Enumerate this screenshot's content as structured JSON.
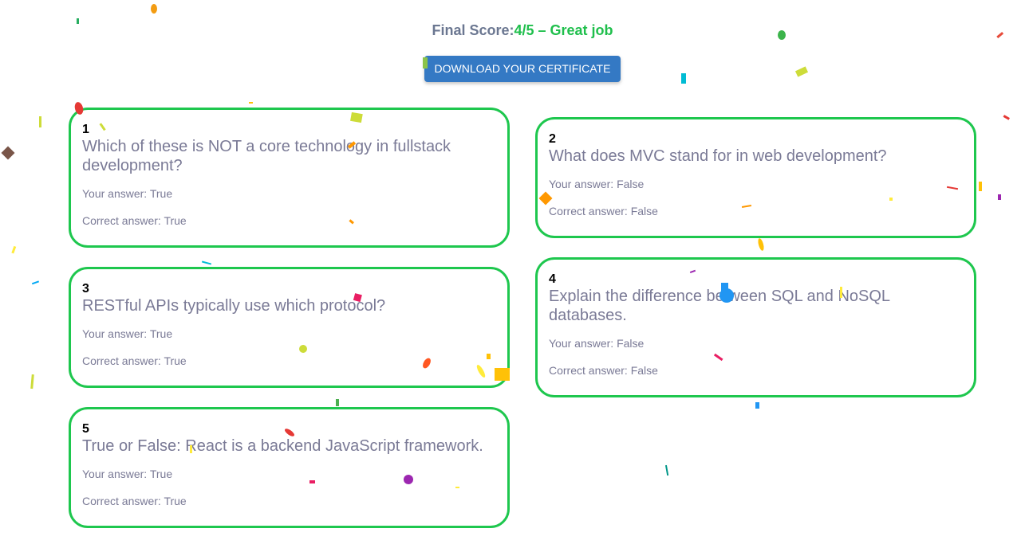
{
  "summary": {
    "final_score_label": "Final Score:",
    "final_score_value": "4/5 – Great job",
    "certificate_button_label": "DOWNLOAD YOUR CERTIFICATE"
  },
  "questions": [
    {
      "number": "1",
      "text": "Which of these is NOT a core technology in fullstack development?",
      "your_answer": "Your answer: True",
      "correct_answer": "Correct answer: True"
    },
    {
      "number": "2",
      "text": "What does MVC stand for in web development?",
      "your_answer": "Your answer: False",
      "correct_answer": "Correct answer: False"
    },
    {
      "number": "3",
      "text": "RESTful APIs typically use which protocol?",
      "your_answer": "Your answer: True",
      "correct_answer": "Correct answer: True"
    },
    {
      "number": "4",
      "text": "Explain the difference between SQL and NoSQL databases.",
      "your_answer": "Your answer: False",
      "correct_answer": "Correct answer: False"
    },
    {
      "number": "5",
      "text": "True or False: React is a backend JavaScript framework.",
      "your_answer": "Your answer: True",
      "correct_answer": "Correct answer: True"
    }
  ],
  "colors": {
    "card_border": "#1ec74e",
    "score_value": "#1fbf4c",
    "button_bg": "#3479c4",
    "muted_text": "#7a7a96"
  }
}
